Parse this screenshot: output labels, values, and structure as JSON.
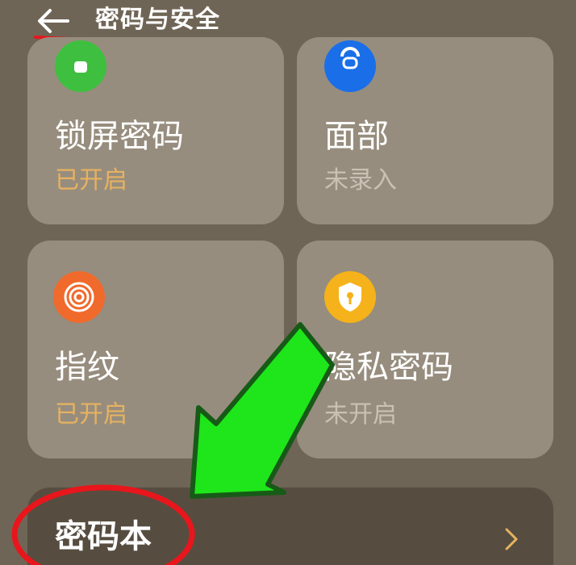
{
  "header": {
    "back_icon": "back-arrow-icon",
    "title": "密码与安全"
  },
  "cards": [
    {
      "label": "锁屏密码",
      "status": "已开启",
      "status_state": "on",
      "icon": "lock-icon",
      "icon_color": "#3fbf3f"
    },
    {
      "label": "面部",
      "status": "未录入",
      "status_state": "off",
      "icon": "face-icon",
      "icon_color": "#1a6fe8"
    },
    {
      "label": "指纹",
      "status": "已开启",
      "status_state": "on",
      "icon": "fingerprint-icon",
      "icon_color": "#f06a2c"
    },
    {
      "label": "隐私密码",
      "status": "未开启",
      "status_state": "off",
      "icon": "privacy-shield-icon",
      "icon_color": "#f5b21a"
    }
  ],
  "password_book": {
    "label": "密码本",
    "icon": "chevron-right-icon"
  },
  "colors": {
    "background": "#6f6556",
    "card": "#978d7e",
    "status_on": "#e6b260",
    "status_off": "#c9c1b4",
    "annotation_red": "#e8161c",
    "annotation_arrow": "#1ee61a"
  }
}
